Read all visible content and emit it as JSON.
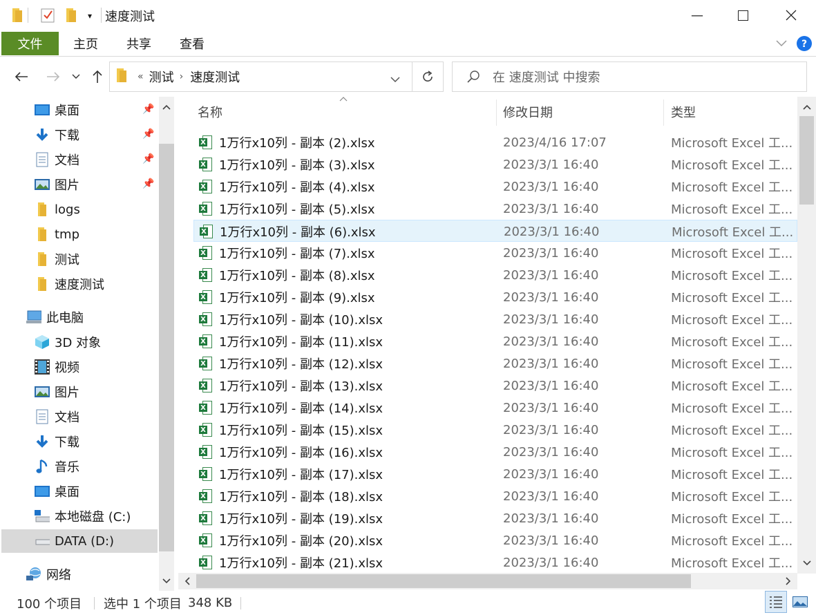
{
  "window": {
    "title": "速度测试",
    "minimize_glyph": "—",
    "maximize_glyph": "☐",
    "close_glyph": "✕"
  },
  "ribbon": {
    "tabs": [
      "文件",
      "主页",
      "共享",
      "查看"
    ],
    "accent": "#5a8c26"
  },
  "address": {
    "overflow": "«",
    "crumbs": [
      "测试",
      "速度测试"
    ]
  },
  "search": {
    "placeholder": "在 速度测试 中搜索"
  },
  "nav": {
    "quick_access": [
      {
        "label": "桌面",
        "icon": "desktop-icon",
        "pinned": true
      },
      {
        "label": "下载",
        "icon": "download-icon",
        "pinned": true
      },
      {
        "label": "文档",
        "icon": "document-icon",
        "pinned": true
      },
      {
        "label": "图片",
        "icon": "picture-icon",
        "pinned": true
      },
      {
        "label": "logs",
        "icon": "folder-icon",
        "pinned": false
      },
      {
        "label": "tmp",
        "icon": "folder-icon",
        "pinned": false
      },
      {
        "label": "测试",
        "icon": "folder-icon",
        "pinned": false
      },
      {
        "label": "速度测试",
        "icon": "folder-icon",
        "pinned": false
      }
    ],
    "this_pc": {
      "label": "此电脑",
      "icon": "computer-icon"
    },
    "pc_items": [
      {
        "label": "3D 对象",
        "icon": "3d-objects-icon"
      },
      {
        "label": "视频",
        "icon": "video-icon"
      },
      {
        "label": "图片",
        "icon": "picture-icon"
      },
      {
        "label": "文档",
        "icon": "document-icon"
      },
      {
        "label": "下载",
        "icon": "download-icon"
      },
      {
        "label": "音乐",
        "icon": "music-icon"
      },
      {
        "label": "桌面",
        "icon": "desktop-icon"
      },
      {
        "label": "本地磁盘 (C:)",
        "icon": "drive-c-icon"
      },
      {
        "label": "DATA (D:)",
        "icon": "drive-icon",
        "selected": true
      }
    ],
    "network": {
      "label": "网络",
      "icon": "network-icon"
    }
  },
  "columns": {
    "name": "名称",
    "date": "修改日期",
    "type": "类型"
  },
  "files": [
    {
      "name": "1万行x10列 - 副本 (2).xlsx",
      "date": "2023/4/16 17:07",
      "type": "Microsoft Excel 工..."
    },
    {
      "name": "1万行x10列 - 副本 (3).xlsx",
      "date": "2023/3/1 16:40",
      "type": "Microsoft Excel 工..."
    },
    {
      "name": "1万行x10列 - 副本 (4).xlsx",
      "date": "2023/3/1 16:40",
      "type": "Microsoft Excel 工..."
    },
    {
      "name": "1万行x10列 - 副本 (5).xlsx",
      "date": "2023/3/1 16:40",
      "type": "Microsoft Excel 工..."
    },
    {
      "name": "1万行x10列 - 副本 (6).xlsx",
      "date": "2023/3/1 16:40",
      "type": "Microsoft Excel 工...",
      "selected": true
    },
    {
      "name": "1万行x10列 - 副本 (7).xlsx",
      "date": "2023/3/1 16:40",
      "type": "Microsoft Excel 工..."
    },
    {
      "name": "1万行x10列 - 副本 (8).xlsx",
      "date": "2023/3/1 16:40",
      "type": "Microsoft Excel 工..."
    },
    {
      "name": "1万行x10列 - 副本 (9).xlsx",
      "date": "2023/3/1 16:40",
      "type": "Microsoft Excel 工..."
    },
    {
      "name": "1万行x10列 - 副本 (10).xlsx",
      "date": "2023/3/1 16:40",
      "type": "Microsoft Excel 工..."
    },
    {
      "name": "1万行x10列 - 副本 (11).xlsx",
      "date": "2023/3/1 16:40",
      "type": "Microsoft Excel 工..."
    },
    {
      "name": "1万行x10列 - 副本 (12).xlsx",
      "date": "2023/3/1 16:40",
      "type": "Microsoft Excel 工..."
    },
    {
      "name": "1万行x10列 - 副本 (13).xlsx",
      "date": "2023/3/1 16:40",
      "type": "Microsoft Excel 工..."
    },
    {
      "name": "1万行x10列 - 副本 (14).xlsx",
      "date": "2023/3/1 16:40",
      "type": "Microsoft Excel 工..."
    },
    {
      "name": "1万行x10列 - 副本 (15).xlsx",
      "date": "2023/3/1 16:40",
      "type": "Microsoft Excel 工..."
    },
    {
      "name": "1万行x10列 - 副本 (16).xlsx",
      "date": "2023/3/1 16:40",
      "type": "Microsoft Excel 工..."
    },
    {
      "name": "1万行x10列 - 副本 (17).xlsx",
      "date": "2023/3/1 16:40",
      "type": "Microsoft Excel 工..."
    },
    {
      "name": "1万行x10列 - 副本 (18).xlsx",
      "date": "2023/3/1 16:40",
      "type": "Microsoft Excel 工..."
    },
    {
      "name": "1万行x10列 - 副本 (19).xlsx",
      "date": "2023/3/1 16:40",
      "type": "Microsoft Excel 工..."
    },
    {
      "name": "1万行x10列 - 副本 (20).xlsx",
      "date": "2023/3/1 16:40",
      "type": "Microsoft Excel 工..."
    },
    {
      "name": "1万行x10列 - 副本 (21).xlsx",
      "date": "2023/3/1 16:40",
      "type": "Microsoft Excel 工..."
    }
  ],
  "status": {
    "item_count": "100 个项目",
    "selection": "选中 1 个项目",
    "size": "348 KB"
  },
  "colors": {
    "selection_bg": "#e5f3fb",
    "selection_border": "#cce8ff",
    "help_blue": "#1a73e8",
    "excel_green": "#1e7a3c"
  }
}
